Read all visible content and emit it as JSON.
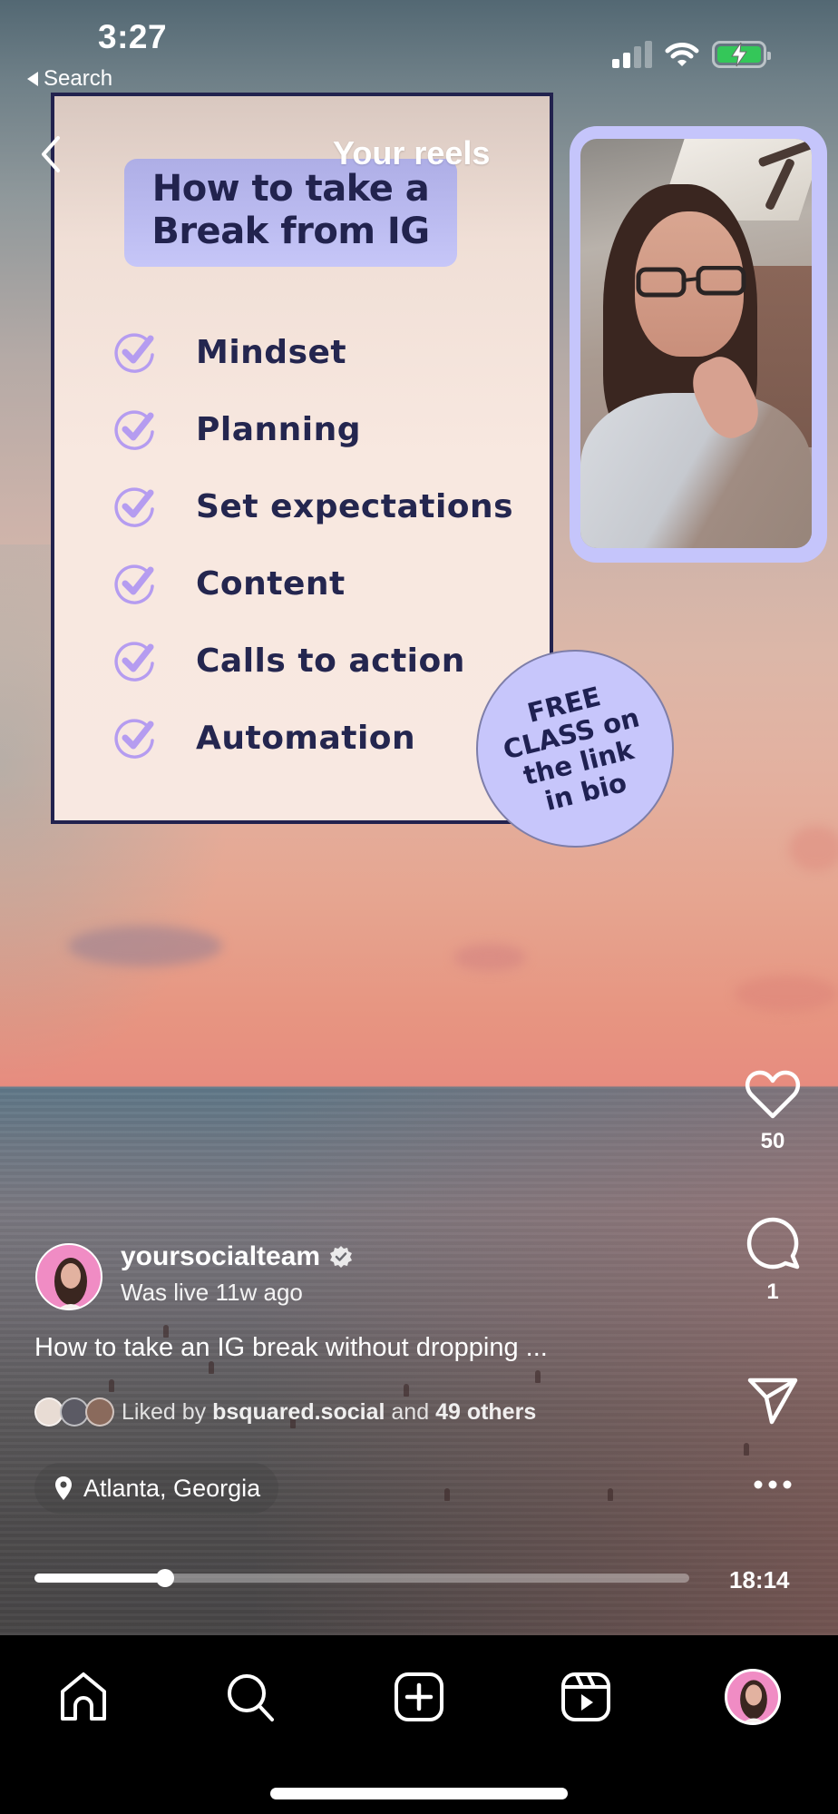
{
  "status_bar": {
    "time": "3:27",
    "back_app_label": "Search",
    "signal_bars_active": 2,
    "signal_bars_total": 4,
    "wifi": "wifi-icon",
    "battery_state": "charging",
    "battery_color": "#34c759"
  },
  "header": {
    "title": "Your reels",
    "back_icon": "chevron-left-icon"
  },
  "reel_overlay": {
    "title_line1": "How to take a",
    "title_line2": "Break from IG",
    "checklist": [
      {
        "label": "Mindset"
      },
      {
        "label": "Planning"
      },
      {
        "label": "Set expectations"
      },
      {
        "label": "Content"
      },
      {
        "label": "Calls to action"
      },
      {
        "label": "Automation"
      }
    ],
    "badge_lines": [
      "FREE",
      "CLASS on",
      "the link",
      "in bio"
    ],
    "accent_color": "#c6c6f8",
    "ink_color": "#22234e"
  },
  "actions": {
    "like_count": "50",
    "comment_count": "1",
    "like_icon": "heart-icon",
    "comment_icon": "comment-icon",
    "share_icon": "send-icon",
    "more_icon": "more-horizontal-icon"
  },
  "author": {
    "username": "yoursocialteam",
    "verified": true,
    "subtitle": "Was live 11w ago"
  },
  "caption": "How to take an IG break without dropping ...",
  "likes": {
    "prefix": "Liked by",
    "user": "bsquared.social",
    "middle": "and",
    "others": "49 others"
  },
  "location": {
    "label": "Atlanta, Georgia",
    "icon": "location-pin-icon"
  },
  "playback": {
    "progress_fraction": 0.2,
    "duration": "18:14"
  },
  "bottom_nav": {
    "items": [
      {
        "name": "home",
        "icon": "home-icon"
      },
      {
        "name": "search",
        "icon": "search-icon"
      },
      {
        "name": "create",
        "icon": "plus-square-icon"
      },
      {
        "name": "reels",
        "icon": "reels-icon"
      },
      {
        "name": "profile",
        "icon": "profile-avatar"
      }
    ]
  }
}
